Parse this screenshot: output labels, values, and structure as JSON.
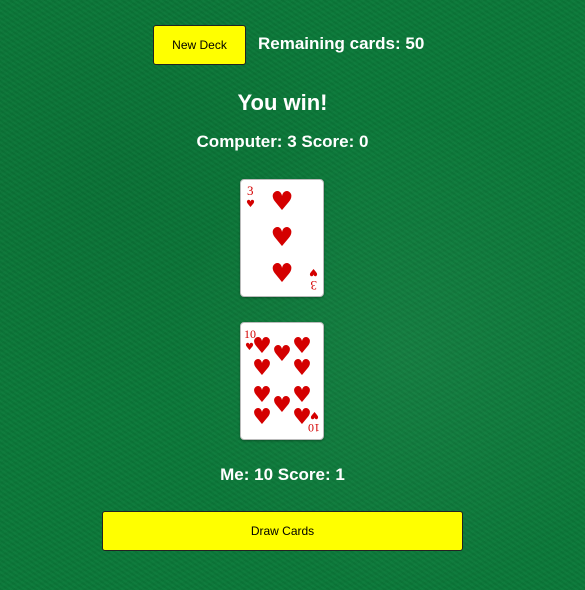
{
  "toolbar": {
    "new_deck_label": "New Deck",
    "remaining_text": "Remaining cards: 50"
  },
  "game": {
    "result_text": "You win!",
    "computer_line": "Computer: 3 Score: 0",
    "me_line": "Me: 10 Score: 1",
    "draw_label": "Draw Cards"
  },
  "cards": {
    "computer": {
      "rank": "3",
      "suit": "hearts",
      "suit_symbol": "♥",
      "color": "#d40000"
    },
    "player": {
      "rank": "10",
      "suit": "hearts",
      "suit_symbol": "♥",
      "color": "#d40000"
    }
  },
  "colors": {
    "felt": "#0b7a3a",
    "button": "#ffff00"
  }
}
